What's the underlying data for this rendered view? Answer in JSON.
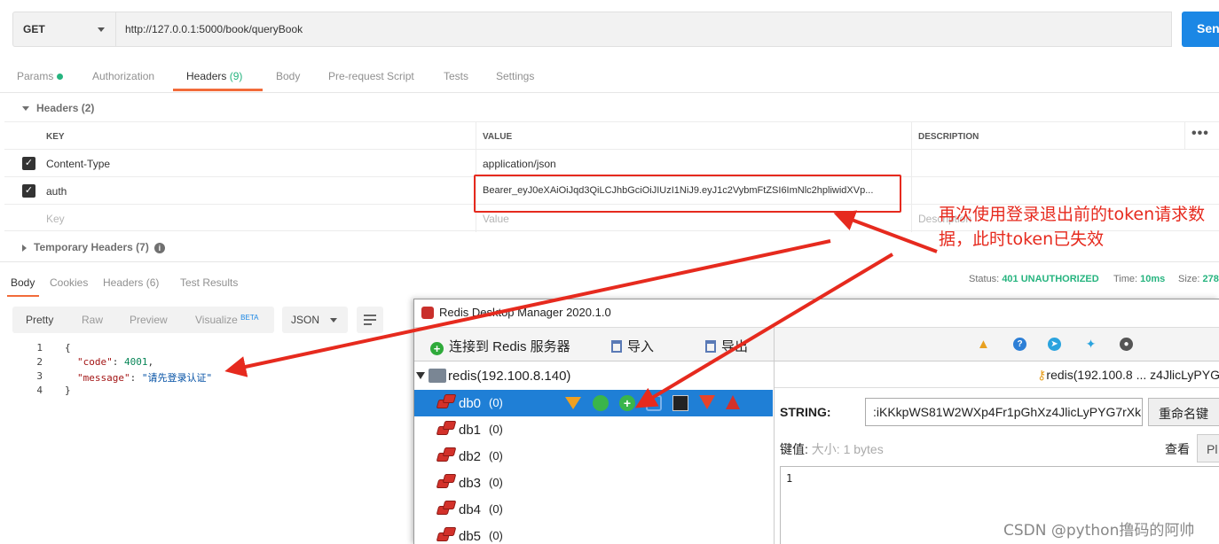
{
  "request": {
    "method": "GET",
    "url": "http://127.0.0.1:5000/book/queryBook",
    "send_label": "Sen"
  },
  "req_tabs": {
    "params": "Params",
    "authorization": "Authorization",
    "headers": "Headers",
    "headers_count": "(9)",
    "body": "Body",
    "prerequest": "Pre-request Script",
    "tests": "Tests",
    "settings": "Settings"
  },
  "headers_section": {
    "title": "Headers (2)",
    "col_key": "KEY",
    "col_value": "VALUE",
    "col_desc": "DESCRIPTION",
    "more": "•••",
    "rows": [
      {
        "key": "Content-Type",
        "value": "application/json"
      },
      {
        "key": "auth",
        "value": "Bearer_eyJ0eXAiOiJqd3QiLCJhbGciOiJIUzI1NiJ9.eyJ1c2VybmFtZSI6ImNlc2hpliwidXVp..."
      }
    ],
    "key_placeholder": "Key",
    "value_placeholder": "Value",
    "desc_placeholder": "Description",
    "temp_headers": "Temporary Headers (7)"
  },
  "response": {
    "tabs": [
      "Body",
      "Cookies",
      "Headers (6)",
      "Test Results"
    ],
    "status_label": "Status:",
    "status_value": "401 UNAUTHORIZED",
    "time_label": "Time:",
    "time_value": "10ms",
    "size_label": "Size:",
    "size_value": "278",
    "view_modes": [
      "Pretty",
      "Raw",
      "Preview",
      "Visualize"
    ],
    "beta": "BETA",
    "format": "JSON",
    "code_lines": [
      {
        "no": "1",
        "text": "{"
      },
      {
        "no": "2",
        "key": "\"code\"",
        "val": "4001",
        "sep": ": ",
        "end": ","
      },
      {
        "no": "3",
        "key": "\"message\"",
        "val": "\"请先登录认证\"",
        "sep": ": ",
        "end": ""
      },
      {
        "no": "4",
        "text": "}"
      }
    ]
  },
  "rdm": {
    "title": "Redis Desktop Manager 2020.1.0",
    "connect": "连接到 Redis 服务器",
    "import": "导入",
    "export": "导出",
    "server": "redis(192.100.8.140)",
    "dbs": [
      {
        "name": "db0",
        "count": "(0)"
      },
      {
        "name": "db1",
        "count": "(0)"
      },
      {
        "name": "db2",
        "count": "(0)"
      },
      {
        "name": "db3",
        "count": "(0)"
      },
      {
        "name": "db4",
        "count": "(0)"
      },
      {
        "name": "db5",
        "count": "(0)"
      }
    ],
    "key_header": "redis(192.100.8 ... z4JlicLyPYG",
    "type_label": "STRING:",
    "key_value": ":iKKkpWS81W2WXp4Fr1pGhXz4JlicLyPYG7rXk",
    "rename": "重命名键",
    "value_label": "键值:",
    "size_label": "大小:",
    "size_value": "1 bytes",
    "view_label": "查看",
    "view_btn": "Pl",
    "value": "1"
  },
  "annotation": {
    "text": "再次使用登录退出前的token请求数据，此时token已失效",
    "color": "#e62a1e"
  },
  "watermark": "CSDN @python撸码的阿帅",
  "colors": {
    "accent_orange": "#f26b3a",
    "status_green": "#26b47f",
    "send_blue": "#1b87e5",
    "rdm_selection": "#1f7fd6"
  }
}
